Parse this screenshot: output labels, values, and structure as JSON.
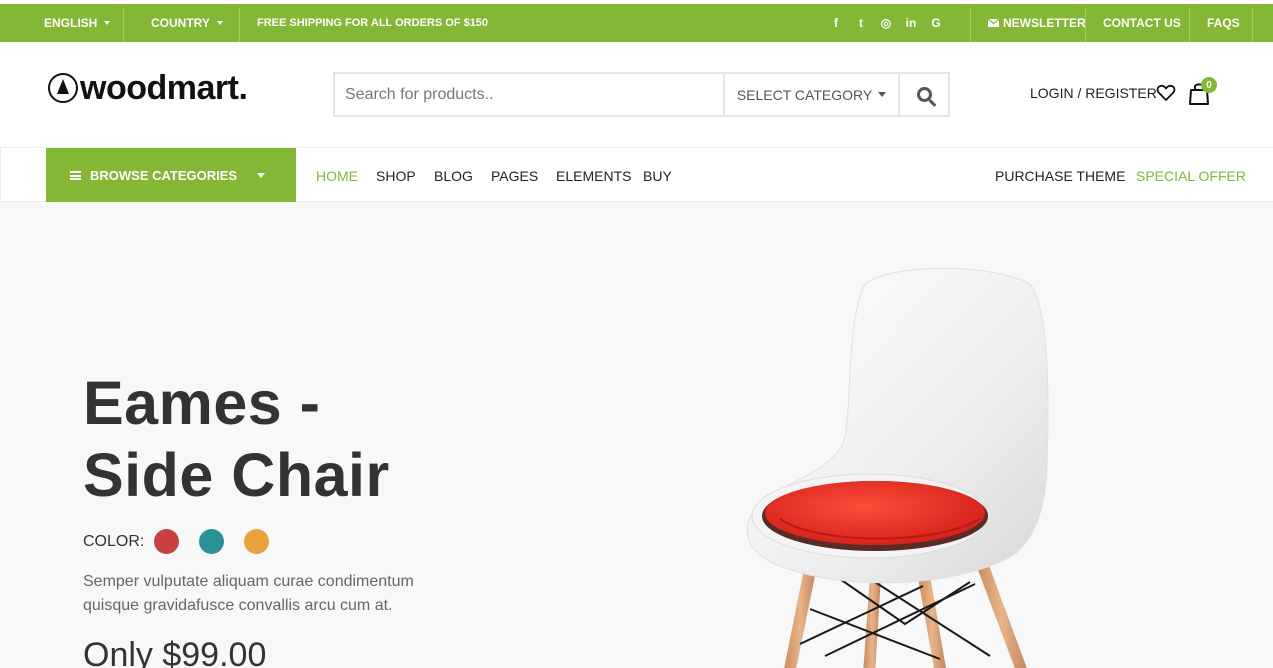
{
  "topbar": {
    "language": "ENGLISH",
    "country": "COUNTRY",
    "shipping": "FREE SHIPPING FOR ALL ORDERS OF $150",
    "social": [
      {
        "icon": "facebook-icon",
        "glyph": "f"
      },
      {
        "icon": "twitter-icon",
        "glyph": "t"
      },
      {
        "icon": "instagram-icon",
        "glyph": "◎"
      },
      {
        "icon": "linkedin-icon",
        "glyph": "in"
      },
      {
        "icon": "google-icon",
        "glyph": "G"
      }
    ],
    "newsletter": "NEWSLETTER",
    "contact": "CONTACT US",
    "faqs": "FAQS"
  },
  "header": {
    "logo": "woodmart.",
    "search_placeholder": "Search for products..",
    "category": "SELECT CATEGORY",
    "login": "LOGIN / REGISTER",
    "cart_count": "0"
  },
  "nav": {
    "browse": "BROWSE CATEGORIES",
    "items": [
      "HOME",
      "SHOP",
      "BLOG",
      "PAGES",
      "ELEMENTS",
      "BUY"
    ],
    "purchase": "PURCHASE THEME",
    "special": "SPECIAL OFFER"
  },
  "hero": {
    "title_line1": "Eames -",
    "title_line2": "Side Chair",
    "color_label": "COLOR:",
    "colors": [
      "#c9413f",
      "#2a9294",
      "#e8a23c"
    ],
    "description": "Semper vulputate aliquam curae condimentum quisque gravidafusce convallis arcu cum at.",
    "price": "Only $99.00"
  },
  "colors": {
    "accent": "#83b735",
    "hero_bg": "#f8f8f8"
  }
}
